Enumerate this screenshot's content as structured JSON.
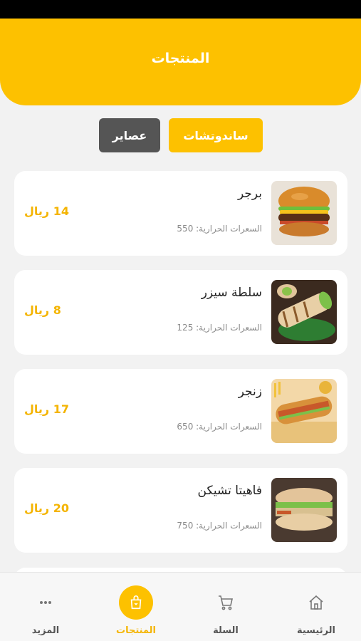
{
  "header": {
    "title": "المنتجات"
  },
  "tabs": [
    {
      "label": "ساندوتشات",
      "active": true
    },
    {
      "label": "عصاير",
      "active": false
    }
  ],
  "products": [
    {
      "name": "برجر",
      "calories": "السعرات الحرارية: 550",
      "price": "14 ريال",
      "image": "burger-image"
    },
    {
      "name": "سلطة سيزر",
      "calories": "السعرات الحرارية: 125",
      "price": "8 ريال",
      "image": "wrap-image"
    },
    {
      "name": "زنجر",
      "calories": "السعرات الحرارية: 650",
      "price": "17 ريال",
      "image": "zinger-image"
    },
    {
      "name": "فاهيتا تشيكن",
      "calories": "السعرات الحرارية: 750",
      "price": "20 ريال",
      "image": "fajita-image"
    }
  ],
  "bottom_nav": [
    {
      "label": "الرئيسية",
      "icon": "home-icon"
    },
    {
      "label": "السلة",
      "icon": "cart-icon"
    },
    {
      "label": "المنتجات",
      "icon": "products-bag-icon",
      "active": true
    },
    {
      "label": "المزيد",
      "icon": "more-dots-icon"
    }
  ],
  "colors": {
    "accent": "#FDC100",
    "price": "#F4B400",
    "inactive_tab": "#555555"
  }
}
